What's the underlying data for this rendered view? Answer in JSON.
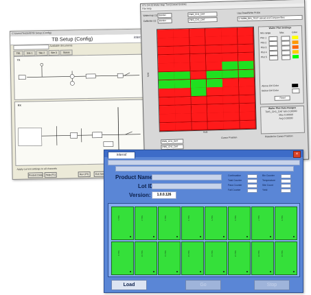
{
  "setup_window": {
    "titlebar": "C:\\Users\\TestSoft\\TB Setup (Config)",
    "title": "TB Setup (Config)",
    "logo": "intersil",
    "field_label": "Available documents",
    "tabs": [
      "TB1",
      "Site 1",
      "Site 2",
      "Site 3",
      "Status"
    ],
    "panel_top_label": "TX",
    "panel_bottom_label": "RX",
    "footer_checkbox": "Apply current settings to all channels",
    "buttons": [
      "Product Data",
      "Help (F1)",
      "Run (F5)",
      "Exit Setup"
    ]
  },
  "map_window": {
    "titlebar": "LT1 (V4.0)   Wafer Map Tool  [Global Enable]",
    "menu": "File  Help",
    "selects": [
      {
        "label": "Wafermap (1)",
        "value": "Bonder"
      },
      {
        "label": "Calibrate (1)",
        "value": "Bonder"
      }
    ],
    "mid_values": [
      "PMS_CH1_DAT",
      "PMS_CH1_DAT"
    ],
    "right_label": "Use Read/Write Probe",
    "right_value": "C:\\SIBM_BIN_TEST  Upload and Compare Bins",
    "side_title": "Wafer Plot Settings",
    "side_columns": [
      "Min range",
      "Max",
      "Color"
    ],
    "side_rows": [
      {
        "label": "Plot 1",
        "color": "#ffff00"
      },
      {
        "label": "Plot 2",
        "color": "#ff9900"
      },
      {
        "label": "Plot 3",
        "color": "#ff6600"
      },
      {
        "label": "Plot 4",
        "color": "#ffcc00"
      },
      {
        "label": "Plot 5",
        "color": "#00ff00"
      }
    ],
    "side_extra": [
      "Above Ctrl Color",
      "Below Ctrl Color"
    ],
    "reset_label": "Reset",
    "stats_title": "Wafer Plot Data Ranges",
    "stats": [
      "TMS_CH1_DAT  Min  0.00000",
      "Max  0.00000",
      "Avg  0.00000"
    ],
    "axis_label": "Axis",
    "grid_colors": {
      "fail": "#ff1a1a",
      "pass": "#20e020"
    },
    "bottom_fields": [
      "PMS_CH1_DAT",
      "PMS_CH1_DAT"
    ],
    "cursor_label": "Cursor Position",
    "results_label": "Results for Cursor Position"
  },
  "load_window": {
    "logo": "intersil",
    "close": "×",
    "product_label": "Product Name:",
    "lot_label": "Lot ID:",
    "version_label": "Version:",
    "version_value": "1.0.0.126",
    "mini_left": [
      "Continuation",
      "Total Counter",
      "Pass Counter",
      "Fail Counter"
    ],
    "mini_right": [
      "Bin Counter",
      "Temperature",
      "Site Count",
      "Yield"
    ],
    "sites": [
      "Site 1",
      "Site 2",
      "Site 3",
      "Site 4",
      "Site 5",
      "Site 6",
      "Site 7",
      "Site 8",
      "Site 9",
      "Site 10",
      "Site 11",
      "Site 12",
      "Site 13",
      "Site 14",
      "Site 15",
      "Site 16"
    ],
    "site_color": "#35e03a",
    "buttons": {
      "load": "Load",
      "go": "Go",
      "stop": "Stop"
    }
  }
}
